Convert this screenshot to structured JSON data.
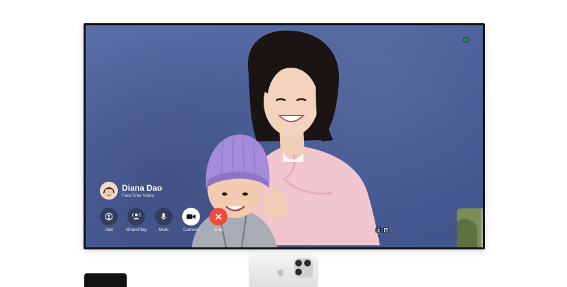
{
  "call": {
    "caller_name": "Diana Dao",
    "call_type": "FaceTime Video"
  },
  "controls": [
    {
      "label": "Add",
      "icon": "add-person-icon"
    },
    {
      "label": "SharePlay",
      "icon": "shareplay-icon"
    },
    {
      "label": "Mute",
      "icon": "microphone-icon"
    },
    {
      "label": "Camera",
      "icon": "video-camera-icon"
    },
    {
      "label": "End",
      "icon": "close-icon"
    }
  ],
  "colors": {
    "wall": "#4b5f99",
    "end_button": "#f04a3b",
    "camera_indicator": "#2a8f3c"
  }
}
